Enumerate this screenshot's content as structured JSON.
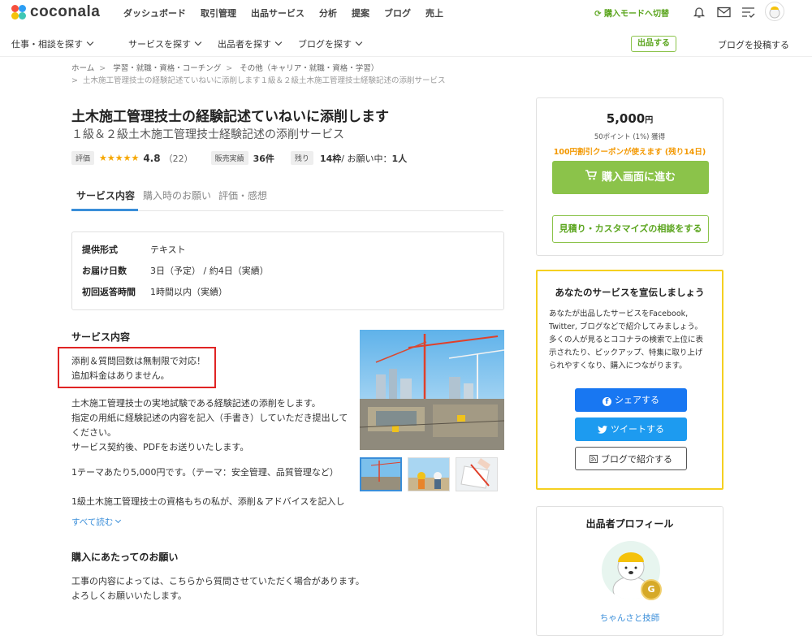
{
  "header": {
    "logo": "coconala",
    "nav": [
      "ダッシュボード",
      "取引管理",
      "出品サービス",
      "分析",
      "提案",
      "ブログ",
      "売上"
    ],
    "mode_switch": "購入モードへ切替"
  },
  "subnav": {
    "items": [
      "仕事・相談を探す",
      "サービスを探す",
      "出品者を探す",
      "ブログを探す"
    ],
    "sell_button": "出品する",
    "blog_post": "ブログを投稿する"
  },
  "breadcrumb": {
    "line1": [
      "ホーム",
      "学習・就職・資格・コーチング",
      "その他（キャリア・就職・資格・学習）"
    ],
    "line2": "土木施工管理技士の経験記述ていねいに添削します１級＆２級土木施工管理技士経験記述の添削サービス"
  },
  "service": {
    "title": "土木施工管理技士の経験記述ていねいに添削します",
    "subtitle": "１級＆２級土木施工管理技士経験記述の添削サービス",
    "rating_label": "評価",
    "stars": "★★★★★",
    "rating": "4.8",
    "reviews": "（22）",
    "sales_label": "販売実績",
    "sales": "36件",
    "remain_label": "残り",
    "remain_count": "14枠",
    "requests_label": " / お願い中：",
    "requests": "1人"
  },
  "tabs": [
    "サービス内容",
    "購入時のお願い",
    "評価・感想"
  ],
  "specs": [
    {
      "label": "提供形式",
      "value": "テキスト"
    },
    {
      "label": "お届け日数",
      "value": "3日（予定） / 約4日（実績）"
    },
    {
      "label": "初回返答時間",
      "value": "1時間以内（実績）"
    }
  ],
  "content": {
    "heading": "サービス内容",
    "highlight": [
      "添削＆質問回数は無制限で対応！",
      "追加料金はありません。"
    ],
    "body1": [
      "土木施工管理技士の実地試験である経験記述の添削をします。",
      "指定の用紙に経験記述の内容を記入（手書き）していただき提出して",
      "ください。",
      "サービス契約後、PDFをお送りいたします。"
    ],
    "body2": "1テーマあたり5,000円です。（テーマ：安全管理、品質管理など）",
    "body3": "1級土木施工管理技士の資格もちの私が、添削＆アドバイスを記入し",
    "read_more": "すべて読む",
    "request_heading": "購入にあたってのお願い",
    "request_body": [
      "工事の内容によっては、こちらから質問させていただく場合があります。",
      "よろしくお願いいたします。"
    ]
  },
  "buy": {
    "price": "5,000",
    "yen": "円",
    "points": "50ポイント (1%) 獲得",
    "coupon": "100円割引クーポンが使えます (残り14日)",
    "buy_button": "購入画面に進む",
    "consult_button": "見積り・カスタマイズの相談をする"
  },
  "promo": {
    "title": "あなたのサービスを宣伝しましょう",
    "body": [
      "あなたが出品したサービスをFacebook,",
      "Twitter, ブログなどで紹介してみましょう。",
      "多くの人が見るとココナラの検索で上位に表",
      "示されたり、ピックアップ、特集に取り上げ",
      "られやすくなり、購入につながります。"
    ],
    "share": "シェアする",
    "tweet": "ツイートする",
    "blog": "ブログで紹介する"
  },
  "profile": {
    "title": "出品者プロフィール",
    "badge": "G",
    "name": "ちゃんさと技師"
  },
  "colors": {
    "accent_green": "#8bc34a",
    "coupon_orange": "#f39800",
    "facebook": "#1877f2",
    "twitter": "#1d9bf0",
    "link_blue": "#3a8ed9",
    "promo_border": "#f5d020"
  }
}
